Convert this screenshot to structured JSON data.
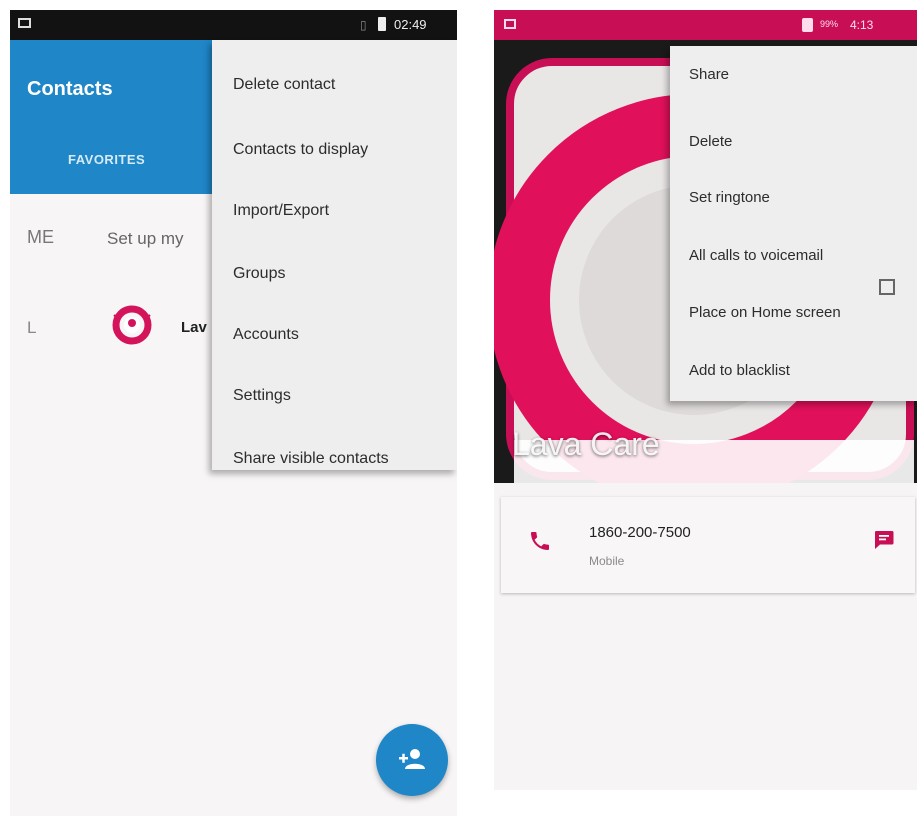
{
  "colors": {
    "contacts_accent": "#1f86c8",
    "lava_accent": "#c80f55",
    "menu_background": "#eeeeee"
  },
  "left_screen": {
    "status_bar": {
      "time": "02:49"
    },
    "app_bar": {
      "title": "Contacts",
      "tab_favorites": "FAVORITES"
    },
    "me_row": {
      "section": "ME",
      "text": "Set up my"
    },
    "contact_row": {
      "section": "L",
      "name": "Lav",
      "avatar_icon": "lava-care-logo-icon"
    },
    "overflow_menu": [
      "Delete contact",
      "Contacts to display",
      "Import/Export",
      "Groups",
      "Accounts",
      "Settings",
      "Share visible contacts"
    ],
    "fab_icon": "add-contact-icon"
  },
  "right_screen": {
    "status_bar": {
      "battery": "99%",
      "time": "4:13"
    },
    "hero": {
      "contact_name": "Lava Care"
    },
    "overflow_menu": [
      {
        "label": "Share"
      },
      {
        "label": "Delete"
      },
      {
        "label": "Set ringtone"
      },
      {
        "label": "All calls to voicemail",
        "checkbox": false
      },
      {
        "label": "Place on Home screen"
      },
      {
        "label": "Add to blacklist"
      }
    ],
    "phone_entry": {
      "number": "1860-200-7500",
      "type": "Mobile",
      "call_icon": "phone-icon",
      "message_icon": "message-icon"
    }
  }
}
